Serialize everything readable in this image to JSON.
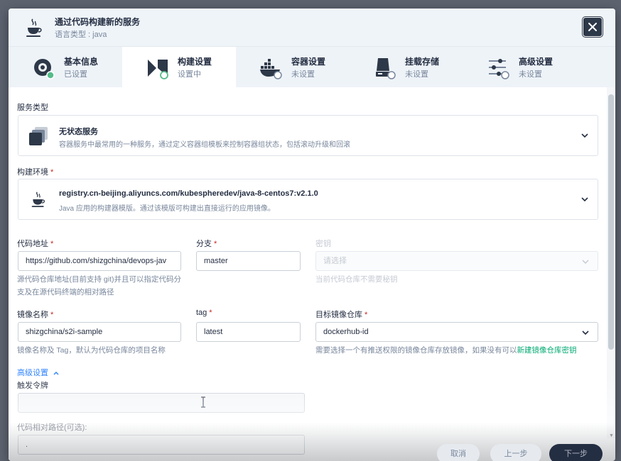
{
  "header": {
    "title": "通过代码构建新的服务",
    "subtitle": "语言类型 : java"
  },
  "steps": [
    {
      "label": "基本信息",
      "status": "已设置",
      "icon": "info-icon"
    },
    {
      "label": "构建设置",
      "status": "设置中",
      "icon": "build-icon"
    },
    {
      "label": "容器设置",
      "status": "未设置",
      "icon": "docker-icon"
    },
    {
      "label": "挂载存储",
      "status": "未设置",
      "icon": "storage-icon"
    },
    {
      "label": "高级设置",
      "status": "未设置",
      "icon": "sliders-icon"
    }
  ],
  "service_type": {
    "label": "服务类型",
    "title": "无状态服务",
    "desc": "容器服务中最常用的一种服务，通过定义容器组模板来控制容器组状态，包括滚动升级和回滚"
  },
  "build_env": {
    "label": "构建环境",
    "required": "*",
    "title": "registry.cn-beijing.aliyuncs.com/kubespheredev/java-8-centos7:v2.1.0",
    "desc": "Java 应用的构建器模版。通过该模版可构建出直接运行的应用镜像。"
  },
  "code_url": {
    "label": "代码地址",
    "required": "*",
    "value": "https://github.com/shizgchina/devops-jav",
    "hint": "源代码仓库地址(目前支持 git)并且可以指定代码分支及在源代码终端的相对路径"
  },
  "branch": {
    "label": "分支",
    "required": "*",
    "value": "master"
  },
  "secret": {
    "label": "密钥",
    "placeholder": "请选择",
    "hint": "当前代码仓库不需要秘钥"
  },
  "image_name": {
    "label": "镜像名称",
    "required": "*",
    "value": "shizgchina/s2i-sample",
    "hint": "镜像名称及 Tag，默认为代码仓库的项目名称"
  },
  "tag": {
    "label": "tag",
    "required": "*",
    "value": "latest"
  },
  "target_registry": {
    "label": "目标镜像仓库",
    "required": "*",
    "value": "dockerhub-id",
    "hint": "需要选择一个有推送权限的镜像仓库存放镜像，如果没有可以",
    "hint_link": "新建镜像仓库密钥"
  },
  "advanced": {
    "label": "高级设置"
  },
  "trigger_token": {
    "label": "触发令牌",
    "value": ""
  },
  "relative_path": {
    "label": "代码相对路径(可选):",
    "value": "."
  },
  "footer": {
    "cancel": "取消",
    "prev": "上一步",
    "next": "下一步"
  },
  "colors": {
    "accent": "#3385ff",
    "success": "#55bc8a",
    "link": "#00aa72",
    "dark": "#242e42"
  }
}
